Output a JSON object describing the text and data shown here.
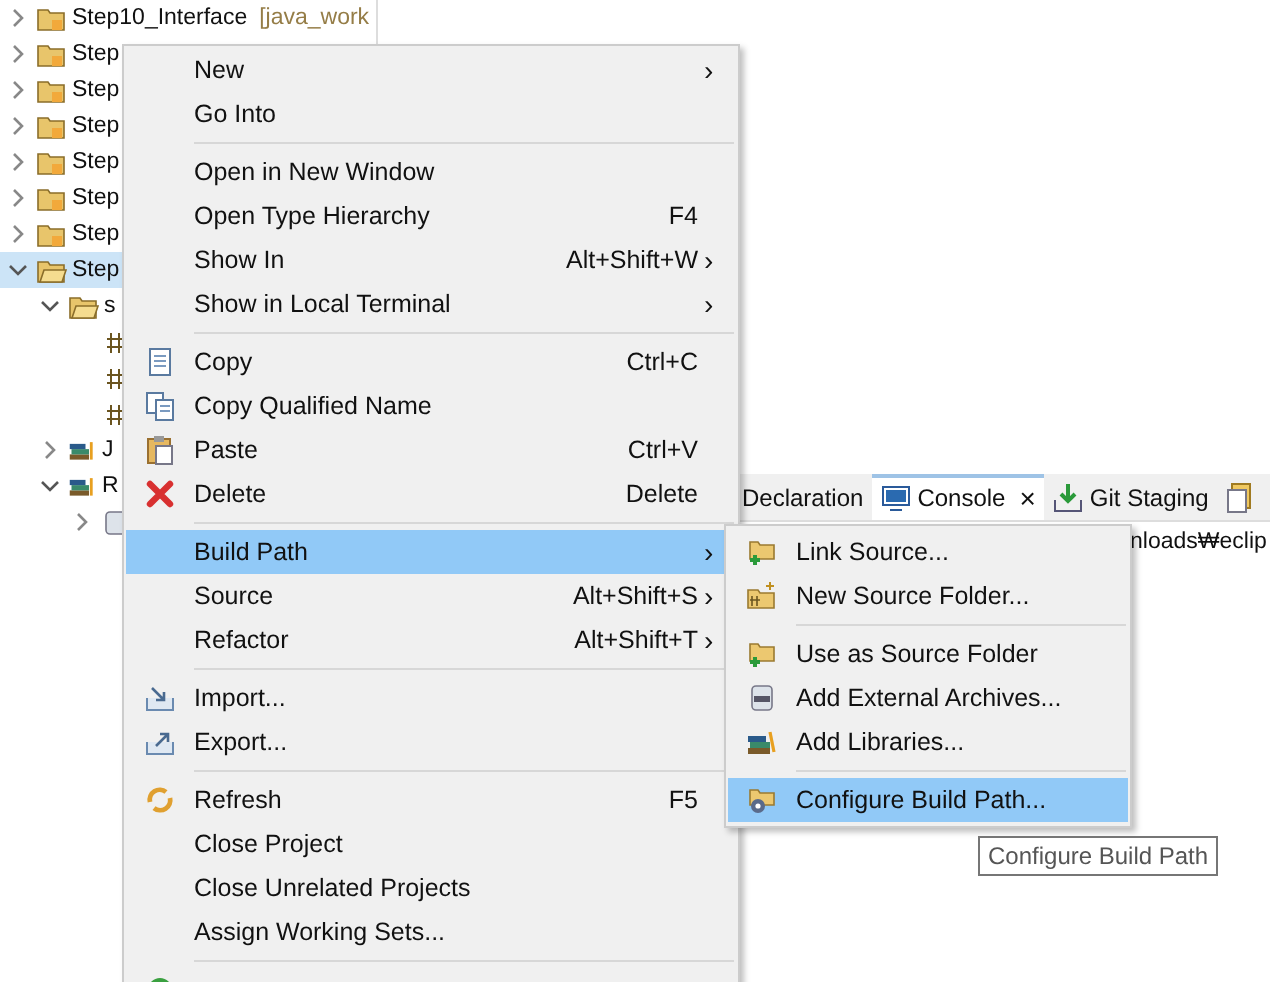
{
  "tree": [
    {
      "kind": "project",
      "label": "Step10_Interface",
      "decoration": "[java_work",
      "expanded": false,
      "selected": false
    },
    {
      "kind": "project",
      "label": "Step",
      "expanded": false,
      "selected": false
    },
    {
      "kind": "project",
      "label": "Step",
      "expanded": false,
      "selected": false
    },
    {
      "kind": "project",
      "label": "Step",
      "expanded": false,
      "selected": false
    },
    {
      "kind": "project",
      "label": "Step",
      "expanded": false,
      "selected": false
    },
    {
      "kind": "project",
      "label": "Step",
      "expanded": false,
      "selected": false
    },
    {
      "kind": "project",
      "label": "Step",
      "expanded": false,
      "selected": false
    },
    {
      "kind": "project",
      "label": "Step",
      "expanded": true,
      "selected": true,
      "children": [
        {
          "kind": "folder",
          "label": "s",
          "expanded": true,
          "selected": false,
          "children": [
            {
              "kind": "package",
              "selected": false
            },
            {
              "kind": "package",
              "selected": false
            },
            {
              "kind": "package",
              "selected": false
            }
          ]
        },
        {
          "kind": "library",
          "label": "J",
          "expanded": false,
          "selected": false
        },
        {
          "kind": "library",
          "label": "R",
          "expanded": true,
          "selected": false,
          "children": [
            {
              "kind": "jar",
              "expanded": false,
              "selected": false
            }
          ]
        }
      ]
    }
  ],
  "panel": {
    "tabs": [
      {
        "label": "Declaration",
        "selected": false
      },
      {
        "label": "Console",
        "selected": true
      },
      {
        "label": "Git Staging",
        "selected": false
      },
      {
        "selected": false
      }
    ],
    "tab_close": "×",
    "path_text": "nloads₩eclip"
  },
  "context_menu": {
    "items": [
      {
        "kind": "item",
        "label": "New",
        "submenu": true,
        "selected": false
      },
      {
        "kind": "item",
        "label": "Go Into",
        "submenu": false,
        "selected": false
      },
      {
        "kind": "separator"
      },
      {
        "kind": "item",
        "label": "Open in New Window",
        "submenu": false,
        "selected": false
      },
      {
        "kind": "item",
        "label": "Open Type Hierarchy",
        "shortcut": "F4",
        "submenu": false,
        "selected": false
      },
      {
        "kind": "item",
        "label": "Show In",
        "shortcut": "Alt+Shift+W",
        "submenu": true,
        "selected": false
      },
      {
        "kind": "item",
        "label": "Show in Local Terminal",
        "submenu": true,
        "selected": false
      },
      {
        "kind": "separator"
      },
      {
        "kind": "item",
        "label": "Copy",
        "shortcut": "Ctrl+C",
        "submenu": false,
        "selected": false
      },
      {
        "kind": "item",
        "label": "Copy Qualified Name",
        "submenu": false,
        "selected": false
      },
      {
        "kind": "item",
        "label": "Paste",
        "shortcut": "Ctrl+V",
        "submenu": false,
        "selected": false
      },
      {
        "kind": "item",
        "label": "Delete",
        "shortcut": "Delete",
        "submenu": false,
        "selected": false
      },
      {
        "kind": "separator"
      },
      {
        "kind": "item",
        "label": "Build Path",
        "submenu": true,
        "selected": true
      },
      {
        "kind": "item",
        "label": "Source",
        "shortcut": "Alt+Shift+S",
        "submenu": true,
        "selected": false
      },
      {
        "kind": "item",
        "label": "Refactor",
        "shortcut": "Alt+Shift+T",
        "submenu": true,
        "selected": false
      },
      {
        "kind": "separator"
      },
      {
        "kind": "item",
        "label": "Import...",
        "submenu": false,
        "selected": false
      },
      {
        "kind": "item",
        "label": "Export...",
        "submenu": false,
        "selected": false
      },
      {
        "kind": "separator"
      },
      {
        "kind": "item",
        "label": "Refresh",
        "shortcut": "F5",
        "submenu": false,
        "selected": false
      },
      {
        "kind": "item",
        "label": "Close Project",
        "submenu": false,
        "selected": false
      },
      {
        "kind": "item",
        "label": "Close Unrelated Projects",
        "submenu": false,
        "selected": false
      },
      {
        "kind": "item",
        "label": "Assign Working Sets...",
        "submenu": false,
        "selected": false
      },
      {
        "kind": "separator"
      },
      {
        "kind": "item",
        "selected": false
      }
    ],
    "arrow": "›"
  },
  "submenu": {
    "items": [
      {
        "kind": "item",
        "label": "Link Source...",
        "selected": false
      },
      {
        "kind": "item",
        "label": "New Source Folder...",
        "selected": false
      },
      {
        "kind": "separator"
      },
      {
        "kind": "item",
        "label": "Use as Source Folder",
        "selected": false
      },
      {
        "kind": "item",
        "label": "Add External Archives...",
        "selected": false
      },
      {
        "kind": "item",
        "label": "Add Libraries...",
        "selected": false
      },
      {
        "kind": "separator"
      },
      {
        "kind": "item",
        "label": "Configure Build Path...",
        "selected": true
      }
    ]
  },
  "tooltip": {
    "text": "Configure Build Path"
  }
}
